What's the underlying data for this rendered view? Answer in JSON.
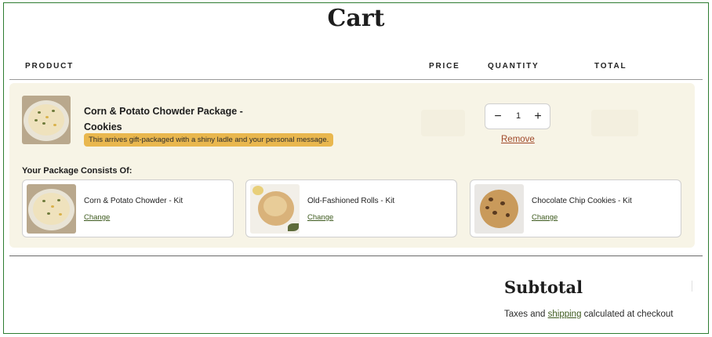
{
  "page": {
    "title": "Cart"
  },
  "table": {
    "headers": {
      "product": "PRODUCT",
      "price": "PRICE",
      "quantity": "QUANTITY",
      "total": "TOTAL"
    }
  },
  "line_item": {
    "name_line1": "Corn & Potato Chowder Package -",
    "name_line2": "Cookies",
    "gift_note": "This arrives gift-packaged with a shiny ladle and your personal message.",
    "quantity": "1",
    "decrement_symbol": "−",
    "increment_symbol": "+",
    "remove_label": "Remove",
    "package_heading": "Your Package Consists Of:",
    "components": [
      {
        "title": "Corn & Potato Chowder - Kit",
        "change_label": "Change",
        "image_icon": "chowder-bowl-image"
      },
      {
        "title": "Old-Fashioned Rolls - Kit",
        "change_label": "Change",
        "image_icon": "bread-roll-image"
      },
      {
        "title": "Chocolate Chip Cookies - Kit",
        "change_label": "Change",
        "image_icon": "cookie-image"
      }
    ]
  },
  "summary": {
    "subtotal_title": "Subtotal",
    "tax_prefix": "Taxes and ",
    "shipping_link": "shipping",
    "tax_suffix": " calculated at checkout"
  },
  "colors": {
    "accent_green_border": "#2e7d32",
    "package_background": "#f7f4e6",
    "gift_note_background": "#e9b74e",
    "remove_link": "#a0492a",
    "change_link": "#3d5a1e"
  }
}
